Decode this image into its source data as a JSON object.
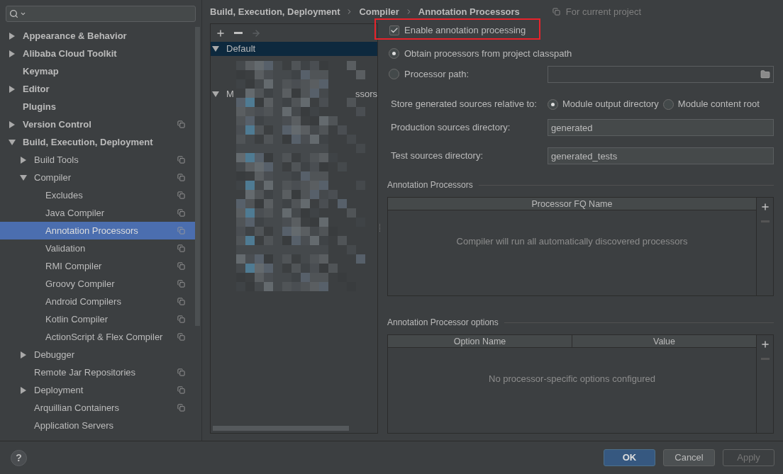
{
  "sidebar": {
    "items": [
      {
        "label": "Appearance & Behavior",
        "expanded": false,
        "selected": false,
        "project_level": false
      },
      {
        "label": "Alibaba Cloud Toolkit",
        "expanded": false,
        "selected": false,
        "project_level": false
      },
      {
        "label": "Keymap",
        "selected": false,
        "project_level": false
      },
      {
        "label": "Editor",
        "expanded": false,
        "selected": false,
        "project_level": false
      },
      {
        "label": "Plugins",
        "selected": false,
        "project_level": false
      },
      {
        "label": "Version Control",
        "expanded": false,
        "selected": false,
        "project_level": true
      },
      {
        "label": "Build, Execution, Deployment",
        "expanded": true,
        "selected": false,
        "project_level": false,
        "children": [
          {
            "label": "Build Tools",
            "expanded": false,
            "selected": false,
            "project_level": true
          },
          {
            "label": "Compiler",
            "expanded": true,
            "selected": false,
            "project_level": true,
            "children": [
              {
                "label": "Excludes",
                "selected": false,
                "project_level": true
              },
              {
                "label": "Java Compiler",
                "selected": false,
                "project_level": true
              },
              {
                "label": "Annotation Processors",
                "selected": true,
                "project_level": true
              },
              {
                "label": "Validation",
                "selected": false,
                "project_level": true
              },
              {
                "label": "RMI Compiler",
                "selected": false,
                "project_level": true
              },
              {
                "label": "Groovy Compiler",
                "selected": false,
                "project_level": true
              },
              {
                "label": "Android Compilers",
                "selected": false,
                "project_level": true
              },
              {
                "label": "Kotlin Compiler",
                "selected": false,
                "project_level": true
              },
              {
                "label": "ActionScript & Flex Compiler",
                "selected": false,
                "project_level": true
              }
            ]
          },
          {
            "label": "Debugger",
            "expanded": false,
            "selected": false,
            "project_level": false
          },
          {
            "label": "Remote Jar Repositories",
            "selected": false,
            "project_level": true
          },
          {
            "label": "Deployment",
            "expanded": false,
            "selected": false,
            "project_level": true
          },
          {
            "label": "Arquillian Containers",
            "selected": false,
            "project_level": true
          },
          {
            "label": "Application Servers",
            "selected": false,
            "project_level": false
          }
        ]
      }
    ]
  },
  "breadcrumb": [
    "Build, Execution, Deployment",
    "Compiler",
    "Annotation Processors"
  ],
  "scope_note": "For current project",
  "profiles": {
    "toolbar": [
      {
        "kind": "add",
        "disabled": false
      },
      {
        "kind": "remove",
        "disabled": false
      },
      {
        "kind": "move",
        "disabled": true
      }
    ],
    "items": [
      {
        "label": "Default",
        "expanded": true,
        "selected": true
      },
      {
        "label_start": "M",
        "label_end": "ssors",
        "expanded": true,
        "selected": false
      }
    ]
  },
  "enable_processing": {
    "label": "Enable annotation processing",
    "checked": true,
    "highlighted": true
  },
  "source": [
    {
      "label": "Obtain processors from project classpath",
      "selected": true
    },
    {
      "label": "Processor path:",
      "selected": false
    }
  ],
  "store_relative": {
    "label": "Store generated sources relative to:",
    "options": [
      {
        "label": "Module output directory",
        "selected": true
      },
      {
        "label": "Module content root",
        "selected": false
      }
    ]
  },
  "directories": [
    {
      "label": "Production sources directory:",
      "value": "generated"
    },
    {
      "label": "Test sources directory:",
      "value": "generated_tests"
    }
  ],
  "processors": {
    "title": "Annotation Processors",
    "columns": [
      "Processor FQ Name"
    ],
    "empty_text": "Compiler will run all automatically discovered processors",
    "remove_disabled": true
  },
  "options": {
    "title": "Annotation Processor options",
    "columns": [
      "Option Name",
      "Value"
    ],
    "empty_text": "No processor-specific options configured",
    "remove_disabled": true
  },
  "help": "?",
  "buttons": [
    {
      "label": "OK",
      "kind": "default",
      "disabled": false
    },
    {
      "label": "Cancel",
      "kind": "normal",
      "disabled": false
    },
    {
      "label": "Apply",
      "kind": "normal",
      "disabled": true
    }
  ]
}
